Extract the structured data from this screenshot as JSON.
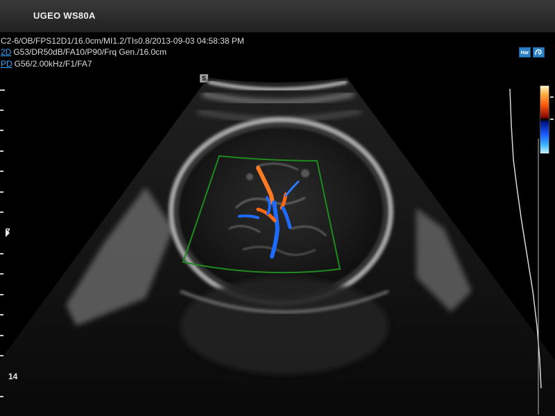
{
  "header": {
    "device_name": "UGEO WS80A"
  },
  "params": {
    "line1": "C2-6/OB/FPS12D1/16.0cm/MI1.2/TIs0.8/2013-09-03 04:58:38 PM",
    "line2_mode": "2D",
    "line2_text": "G53/DR50dB/FA10/P90/Frq Gen./16.0cm",
    "line3_mode": "PD",
    "line3_text": "G56/2.00kHz/F1/FA7"
  },
  "badge": "S",
  "depth": {
    "labels": [
      "7",
      "14"
    ]
  },
  "icons": {
    "right_top": [
      "Har",
      "auto-optimize-icon"
    ]
  },
  "colors": {
    "mode_tag": "#3ea8ff",
    "roi_box": "#1f8a1f",
    "flow_red": "#ff6a1a",
    "flow_blue": "#1e6bff"
  }
}
